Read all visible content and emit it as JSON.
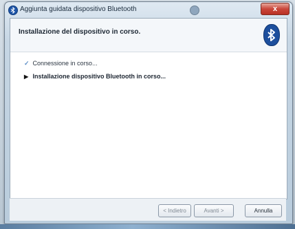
{
  "window": {
    "title": "Aggiunta guidata dispositivo Bluetooth",
    "close_glyph": "x"
  },
  "header": {
    "title": "Installazione del dispositivo in corso."
  },
  "steps": [
    {
      "label": "Connessione in corso...",
      "status": "done",
      "icon": "check-icon"
    },
    {
      "label": "Installazione dispositivo Bluetooth in corso...",
      "status": "current",
      "icon": "arrow-right-icon"
    }
  ],
  "buttons": {
    "back_label": "< Indietro",
    "next_label": "Avanti >",
    "cancel_label": "Annulla"
  },
  "colors": {
    "bluetooth": "#1d4f9d",
    "check": "#5d8fc7",
    "close_button": "#c9463a"
  }
}
